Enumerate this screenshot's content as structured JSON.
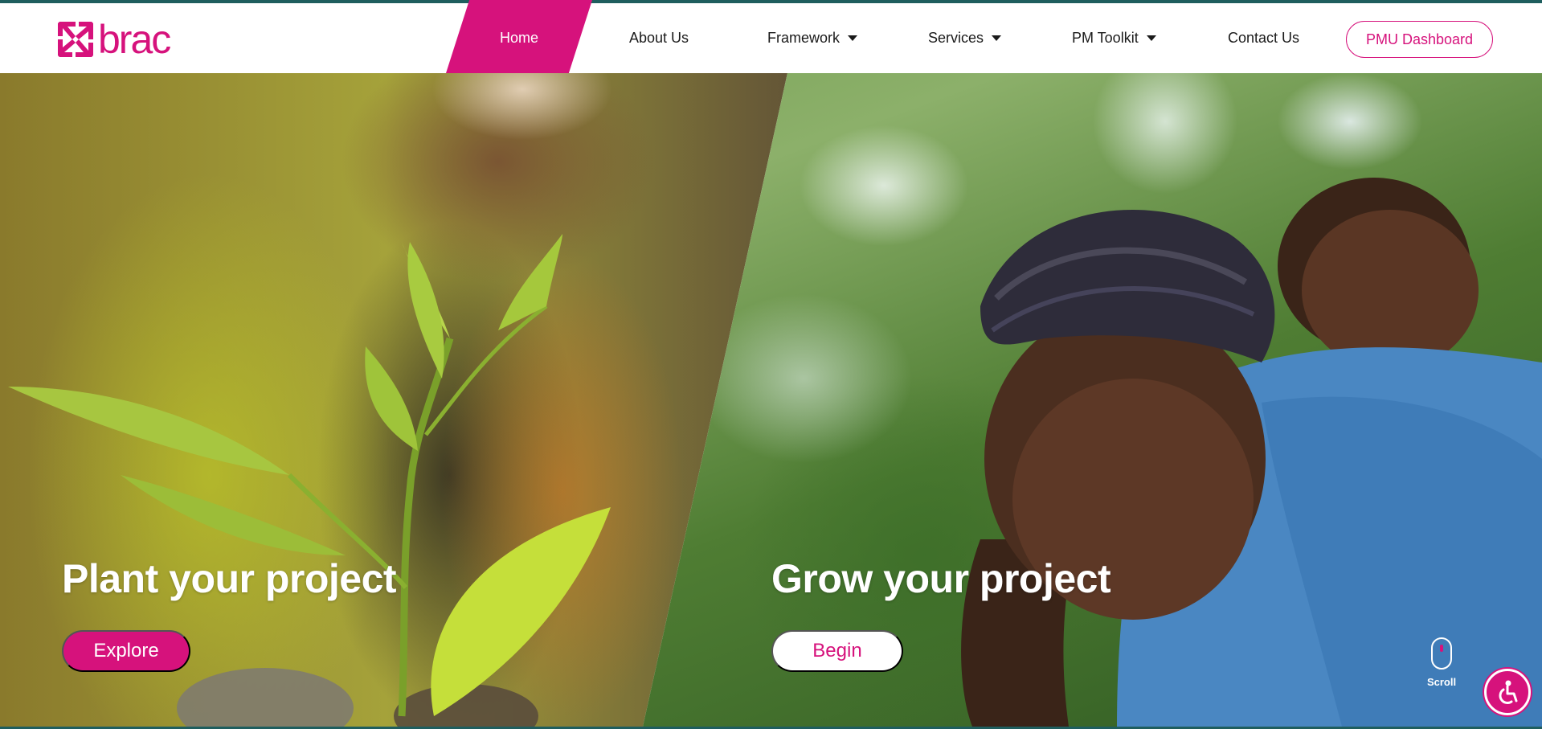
{
  "header": {
    "logo_text": "brac",
    "nav": {
      "home": "Home",
      "about": "About Us",
      "framework": "Framework",
      "services": "Services",
      "pm_toolkit": "PM Toolkit",
      "contact": "Contact Us"
    },
    "dashboard_button": "PMU Dashboard"
  },
  "hero": {
    "left": {
      "title": "Plant your project",
      "button": "Explore"
    },
    "right": {
      "title": "Grow your project",
      "button": "Begin"
    },
    "scroll_label": "Scroll"
  },
  "icons": {
    "logo": "brac-pinwheel-icon",
    "caret": "chevron-down-icon",
    "scroll": "mouse-scroll-icon",
    "accessibility": "accessibility-icon"
  },
  "colors": {
    "brand": "#d6127c",
    "accent_line": "#1f5e5e",
    "text_dark": "#1a1a1a",
    "white": "#ffffff"
  }
}
